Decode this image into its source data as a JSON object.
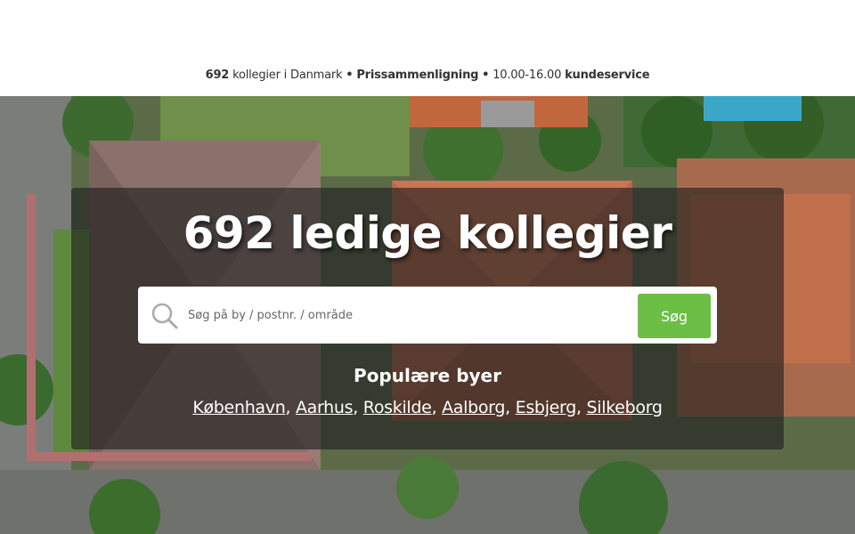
{
  "infoline": {
    "count": "692",
    "count_text": "kollegier i Danmark",
    "dot1": "•",
    "comparison": "Prissammenligning",
    "dot2": "•",
    "hours": "10.00-16.00",
    "service": "kundeservice"
  },
  "hero": {
    "headline": "692 ledige kollegier"
  },
  "search": {
    "placeholder": "Søg på by / postnr. / område",
    "value": "",
    "button_label": "Søg",
    "icon": "search-icon"
  },
  "popular": {
    "title": "Populære byer",
    "cities": [
      "København",
      "Aarhus",
      "Roskilde",
      "Aalborg",
      "Esbjerg",
      "Silkeborg"
    ],
    "separator": ","
  },
  "colors": {
    "accent_green": "#6cbf45",
    "overlay": "#1e1e1e"
  }
}
